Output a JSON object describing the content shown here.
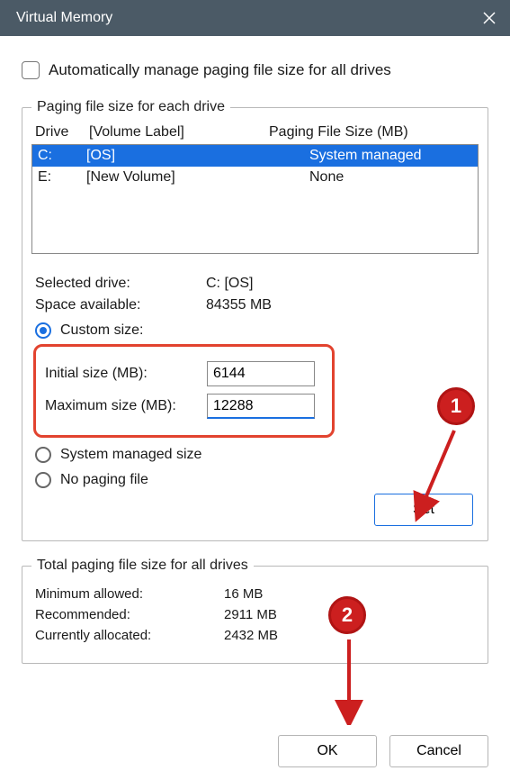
{
  "title": "Virtual Memory",
  "auto_manage_label": "Automatically manage paging file size for all drives",
  "group1_legend": "Paging file size for each drive",
  "headers": {
    "drive": "Drive",
    "volume": "[Volume Label]",
    "paging": "Paging File Size (MB)"
  },
  "drives": [
    {
      "letter": "C:",
      "label": "[OS]",
      "paging": "System managed",
      "selected": true
    },
    {
      "letter": "E:",
      "label": "[New Volume]",
      "paging": "None",
      "selected": false
    }
  ],
  "selected_drive_label": "Selected drive:",
  "selected_drive_value": "C:  [OS]",
  "space_label": "Space available:",
  "space_value": "84355 MB",
  "custom_size_label": "Custom size:",
  "initial_label": "Initial size (MB):",
  "initial_value": "6144",
  "max_label": "Maximum size (MB):",
  "max_value": "12288",
  "system_managed_label": "System managed size",
  "no_paging_label": "No paging file",
  "set_button": "Set",
  "group2_legend": "Total paging file size for all drives",
  "min_allowed_label": "Minimum allowed:",
  "min_allowed_value": "16 MB",
  "recommended_label": "Recommended:",
  "recommended_value": "2911 MB",
  "allocated_label": "Currently allocated:",
  "allocated_value": "2432 MB",
  "ok_button": "OK",
  "cancel_button": "Cancel",
  "annotations": {
    "badge1": "1",
    "badge2": "2"
  }
}
